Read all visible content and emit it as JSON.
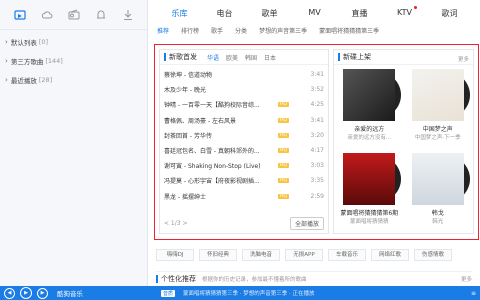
{
  "sidebar": {
    "icons": [
      "music-library-icon",
      "cloud-icon",
      "radio-icon",
      "bell-icon",
      "download-icon"
    ],
    "items": [
      {
        "label": "默认列表",
        "count": "[0]"
      },
      {
        "label": "第三方歌曲",
        "count": "[144]"
      },
      {
        "label": "最近播放",
        "count": "[28]"
      }
    ]
  },
  "tabs": [
    {
      "label": "乐库",
      "active": true
    },
    {
      "label": "电台"
    },
    {
      "label": "歌单"
    },
    {
      "label": "MV"
    },
    {
      "label": "直播"
    },
    {
      "label": "KTV",
      "dot": true
    },
    {
      "label": "歌词"
    }
  ],
  "subtabs": [
    "推荐",
    "排行榜",
    "歌手",
    "分类",
    "梦想的声音第三季",
    "蒙面唱将猜猜猜第三季"
  ],
  "new_songs": {
    "title": "新歌首发",
    "filters": [
      "华语",
      "欧美",
      "韩国",
      "日本"
    ],
    "items": [
      {
        "title": "蔡徐坤 - 信道动物",
        "dur": "3:41"
      },
      {
        "title": "木及少年 - 晚光",
        "dur": "3:52"
      },
      {
        "title": "钟晴 - 一百零一天【酷狗校际音综...",
        "tag": "HQ",
        "dur": "4:25"
      },
      {
        "title": "曹格佩、周汤豪 - 左右风景",
        "tag": "HQ",
        "dur": "3:41"
      },
      {
        "title": "封茶回首 - 芳华传",
        "tag": "HQ",
        "dur": "3:20"
      },
      {
        "title": "喜廷冠包名、白雪 - 真朝科郊外的...",
        "tag": "HQ",
        "dur": "4:17"
      },
      {
        "title": "谢可寅 - Shaking Non-Stop (Live)",
        "tag": "HQ",
        "dur": "3:03"
      },
      {
        "title": "冯提莫 - 心形宇宙【府夜影视剧插...",
        "tag": "HQ",
        "dur": "3:35"
      },
      {
        "title": "黑龙 - 摇摆绅士",
        "tag": "HQ",
        "dur": "2:59"
      }
    ],
    "pager": "< 1/3 >",
    "play_all": "全部播放"
  },
  "new_albums": {
    "title": "新碟上架",
    "more": "更多",
    "items": [
      {
        "name": "亲爱的远方",
        "artist": "亲爱的远方没有..."
      },
      {
        "name": "中国梦之声",
        "artist": "中国梦之声·下一季"
      },
      {
        "name": "蒙面唱将猜猜猜第6期",
        "artist": "蒙面唱将猜猜猜"
      },
      {
        "name": "韩戈",
        "artist": "韩光"
      }
    ]
  },
  "chips": [
    "嗨嗨DJ",
    "怀旧经典",
    "洗脑电音",
    "无损APP",
    "车载音乐",
    "网络红歌",
    "伤感情歌"
  ],
  "reco": {
    "title": "个性化推荐",
    "hint": "根据你的历史记录，参加最不懂着所的歌曲",
    "more": "更多"
  },
  "player": {
    "now": "酷狗音乐",
    "quality": "音质",
    "ticker": "蒙面唱将猜猜猜第三季 · 梦想的声音第三季 · 正在播放",
    "tail": "≡"
  }
}
